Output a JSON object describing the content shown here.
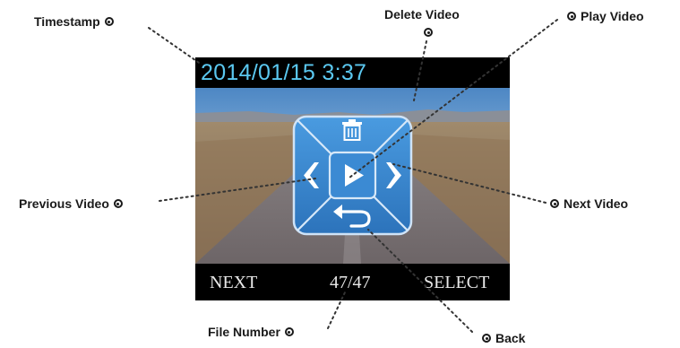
{
  "labels": {
    "timestamp": "Timestamp",
    "delete_video": "Delete Video",
    "play_video": "Play Video",
    "previous_video": "Previous Video",
    "next_video": "Next Video",
    "file_number": "File Number",
    "back": "Back"
  },
  "screen": {
    "timestamp": "2014/01/15 3:37",
    "bottom_bar": {
      "left": "NEXT",
      "center": "47/47",
      "right": "SELECT"
    }
  },
  "colors": {
    "timestamp_text": "#5bc8f0",
    "dpad_blue": "#3d8fd6",
    "dpad_dark": "#2a6fb6",
    "screen_bg": "#000000",
    "label_text": "#1a1a1a"
  },
  "icons": {
    "delete": "trash-icon",
    "play": "play-icon",
    "previous": "chevron-left-icon",
    "next": "chevron-right-icon",
    "back": "return-arrow-icon"
  }
}
